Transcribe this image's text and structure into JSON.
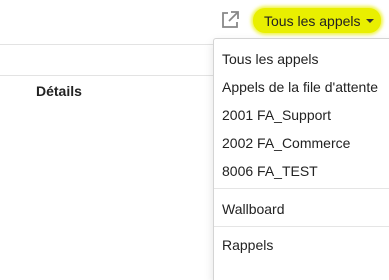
{
  "header": {
    "external_icon": "external-link-icon",
    "dropdown_label": "Tous les appels",
    "highlight_color": "#e9ef00"
  },
  "table": {
    "column_header": "Détails"
  },
  "menu": {
    "items": [
      {
        "label": "Tous les appels"
      },
      {
        "label": "Appels de la file d'attente"
      },
      {
        "label": "2001 FA_Support"
      },
      {
        "label": "2002 FA_Commerce"
      },
      {
        "label": "8006 FA_TEST"
      },
      {
        "label": "Wallboard"
      },
      {
        "label": "Rappels"
      }
    ]
  }
}
